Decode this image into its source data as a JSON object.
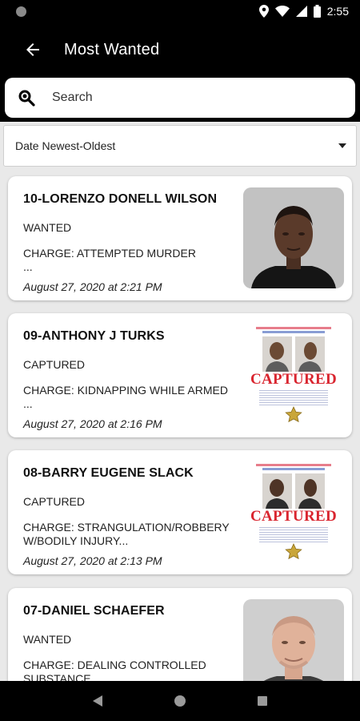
{
  "status_bar": {
    "time": "2:55"
  },
  "header": {
    "title": "Most Wanted"
  },
  "search": {
    "placeholder": "Search"
  },
  "sort": {
    "selected": "Date Newest-Oldest"
  },
  "items": [
    {
      "name": "10-LORENZO DONELL WILSON",
      "status": "WANTED",
      "charge": "CHARGE: ATTEMPTED MURDER",
      "ellipsis": "...",
      "date": "August 27, 2020 at 2:21 PM",
      "image": "mugshot"
    },
    {
      "name": "09-ANTHONY J TURKS",
      "status": "CAPTURED",
      "charge": "CHARGE: KIDNAPPING WHILE ARMED",
      "ellipsis": "...",
      "date": "August 27, 2020 at 2:16 PM",
      "image": "captured-poster",
      "poster_stamp": "CAPTURED"
    },
    {
      "name": "08-BARRY EUGENE SLACK",
      "status": "CAPTURED",
      "charge": "CHARGE: STRANGULATION/ROBBERY W/BODILY INJURY...",
      "ellipsis": "",
      "date": "August 27, 2020 at 2:13 PM",
      "image": "captured-poster",
      "poster_stamp": "CAPTURED"
    },
    {
      "name": "07-DANIEL SCHAEFER",
      "status": "WANTED",
      "charge": "CHARGE: DEALING CONTROLLED SUBSTANCE",
      "ellipsis": "",
      "date": "",
      "image": "mugshot"
    }
  ],
  "colors": {
    "app_bar": "#000000",
    "background": "#e9e9e9",
    "card": "#ffffff",
    "captured_red": "#d9252f"
  },
  "icons": {
    "back": "arrow-left-icon",
    "search": "search-icon",
    "dropdown": "chevron-down-icon",
    "nav_back": "triangle-back-icon",
    "nav_home": "circle-home-icon",
    "nav_recents": "square-recents-icon"
  }
}
